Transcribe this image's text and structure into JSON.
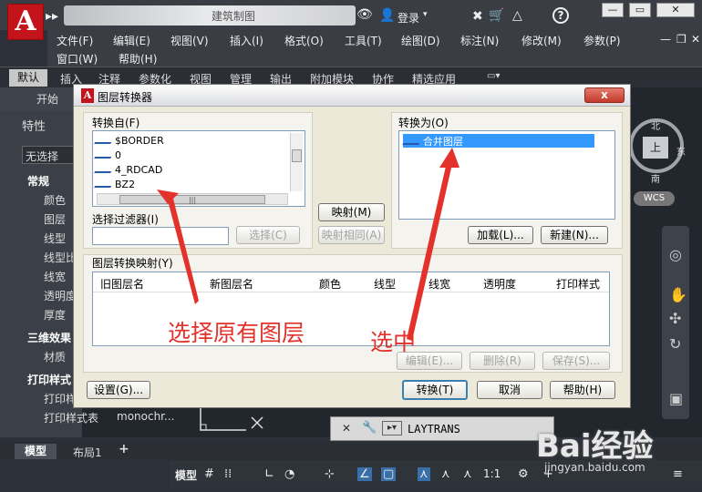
{
  "title_bar": {
    "app_letter": "A",
    "blurred_title": "建筑制图",
    "login": "登录",
    "help": "?"
  },
  "menu": {
    "row1": [
      "文件(F)",
      "编辑(E)",
      "视图(V)",
      "插入(I)",
      "格式(O)",
      "工具(T)",
      "绘图(D)",
      "标注(N)",
      "修改(M)",
      "参数(P)"
    ],
    "row2": [
      "窗口(W)",
      "帮助(H)"
    ]
  },
  "ribbon_tabs": [
    "默认",
    "插入",
    "注释",
    "参数化",
    "视图",
    "管理",
    "输出",
    "附加模块",
    "协作",
    "精选应用"
  ],
  "doc_tab": "开始",
  "left_panel": {
    "title": "特性",
    "no_selection": "无选择",
    "sections": [
      {
        "header": "常规",
        "items": [
          "颜色",
          "图层",
          "线型",
          "线型比",
          "线宽",
          "透明度",
          "厚度"
        ]
      },
      {
        "header": "三维效果",
        "items": [
          "材质"
        ]
      },
      {
        "header": "打印样式",
        "items": [
          "打印样",
          "打印样式表"
        ]
      }
    ],
    "plot_style_value": "monochr..."
  },
  "viewcube": {
    "north": "北",
    "south": "南",
    "east": "东",
    "west": "西",
    "top": "上",
    "wcs": "WCS"
  },
  "command_line": {
    "text": "LAYTRANS"
  },
  "layout_tabs": [
    "模型",
    "布局1",
    "+"
  ],
  "status_bar": {
    "model": "模型",
    "scale": "1:1"
  },
  "dialog": {
    "title": "图层转换器",
    "close": "x",
    "convert_from": {
      "label": "转换自(F)",
      "items": [
        "$BORDER",
        "0",
        "4_RDCAD",
        "BZ2"
      ],
      "filter_label": "选择过滤器(I)",
      "filter_value": "",
      "select_button": "选择(C)"
    },
    "map_button": "映射(M)",
    "map_same_button": "映射相同(A)",
    "convert_to": {
      "label": "转换为(O)",
      "items": [
        "合并图层"
      ],
      "load_button": "加载(L)...",
      "new_button": "新建(N)..."
    },
    "mapping": {
      "label": "图层转换映射(Y)",
      "columns": [
        "旧图层名",
        "新图层名",
        "颜色",
        "线型",
        "线宽",
        "透明度",
        "打印样式"
      ],
      "edit_button": "编辑(E)...",
      "delete_button": "删除(R)",
      "save_button": "保存(S)..."
    },
    "settings_button": "设置(G)...",
    "convert_button": "转换(T)",
    "cancel_button": "取消",
    "help_button": "帮助(H)"
  },
  "annotations": {
    "left": "选择原有图层",
    "right": "选中",
    "color": "#e2322b"
  },
  "watermark": {
    "logo": "Bai经验",
    "url": "jingyan.baidu.com"
  }
}
